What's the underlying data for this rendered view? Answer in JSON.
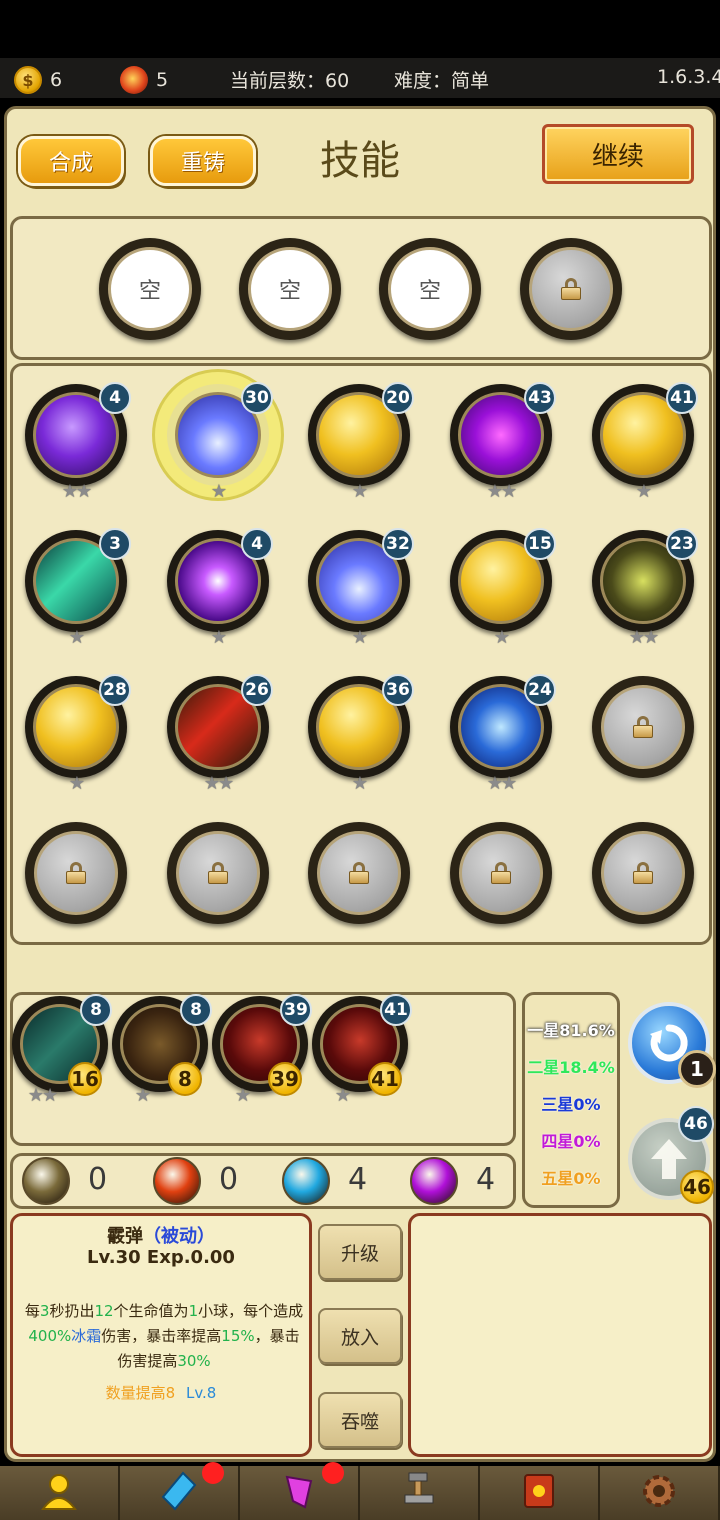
{
  "status_bar": {
    "coins": "6",
    "gems": "5",
    "floor": "当前层数：60",
    "difficulty": "难度：简单",
    "version": "1.6.3.4"
  },
  "header": {
    "merge_label": "合成",
    "recast_label": "重铸",
    "title": "技能",
    "continue_label": "继续"
  },
  "equip_slots": [
    {
      "label": "空"
    },
    {
      "label": "空"
    },
    {
      "label": "空"
    },
    {
      "label": "",
      "locked": true
    }
  ],
  "skills": [
    {
      "level": "4",
      "stars": 2,
      "icon": "purple-lightning-icon"
    },
    {
      "level": "30",
      "stars": 1,
      "icon": "ice-shard-icon",
      "selected": true
    },
    {
      "level": "20",
      "stars": 1,
      "icon": "gold-scroll-icon"
    },
    {
      "level": "43",
      "stars": 2,
      "icon": "purple-vortex-icon"
    },
    {
      "level": "41",
      "stars": 1,
      "icon": "gold-scroll-icon"
    },
    {
      "level": "3",
      "stars": 1,
      "icon": "green-wind-icon"
    },
    {
      "level": "4",
      "stars": 1,
      "icon": "purple-burst-icon"
    },
    {
      "level": "32",
      "stars": 1,
      "icon": "ice-shard-icon"
    },
    {
      "level": "15",
      "stars": 1,
      "icon": "gold-scroll-icon"
    },
    {
      "level": "23",
      "stars": 2,
      "icon": "dark-thunder-icon"
    },
    {
      "level": "28",
      "stars": 1,
      "icon": "gold-scroll-icon"
    },
    {
      "level": "26",
      "stars": 2,
      "icon": "red-shield-icon"
    },
    {
      "level": "36",
      "stars": 1,
      "icon": "gold-scroll-icon"
    },
    {
      "level": "24",
      "stars": 2,
      "icon": "blue-crystal-icon"
    },
    {
      "level": "",
      "locked": true
    },
    {
      "level": "",
      "locked": true
    },
    {
      "level": "",
      "locked": true
    },
    {
      "level": "",
      "locked": true
    },
    {
      "level": "",
      "locked": true
    },
    {
      "level": "",
      "locked": true
    }
  ],
  "inventory": [
    {
      "level": "8",
      "count": "16",
      "stars": 2,
      "icon": "teal-wind-icon"
    },
    {
      "level": "8",
      "count": "8",
      "stars": 1,
      "icon": "cross-icon"
    },
    {
      "level": "39",
      "count": "39",
      "stars": 1,
      "icon": "red-drop-icon"
    },
    {
      "level": "41",
      "count": "41",
      "stars": 1,
      "icon": "red-drop-icon"
    }
  ],
  "star_odds": [
    {
      "text": "一星81.6%",
      "color": "#ffffff"
    },
    {
      "text": "二星18.4%",
      "color": "#2ee85a"
    },
    {
      "text": "三星0%",
      "color": "#1a3ad8"
    },
    {
      "text": "四星0%",
      "color": "#c21ad8"
    },
    {
      "text": "五星0%",
      "color": "#f0a020"
    }
  ],
  "refresh": {
    "count": "1"
  },
  "upgrade": {
    "level": "46",
    "count": "46"
  },
  "orbs": [
    {
      "value": "0",
      "color": "#7a6a3a"
    },
    {
      "value": "0",
      "color": "#e04010"
    },
    {
      "value": "4",
      "color": "#20a8e0"
    },
    {
      "value": "4",
      "color": "#b010d8"
    }
  ],
  "detail": {
    "name": "霰弹",
    "tag": "（被动）",
    "level_exp": "Lv.30 Exp.0.00",
    "desc_parts": [
      {
        "t": "每",
        "c": ""
      },
      {
        "t": "3",
        "c": "#22b24c"
      },
      {
        "t": "秒扔出",
        "c": ""
      },
      {
        "t": "12",
        "c": "#22b24c"
      },
      {
        "t": "个生命值为",
        "c": ""
      },
      {
        "t": "1",
        "c": "#22b24c"
      },
      {
        "t": "小球，每个造成",
        "c": ""
      },
      {
        "t": "400%",
        "c": "#22b24c"
      },
      {
        "t": "冰霜",
        "c": "#2a6ad8"
      },
      {
        "t": "伤害，暴击率提高",
        "c": ""
      },
      {
        "t": "15%",
        "c": "#22b24c"
      },
      {
        "t": "，暴击伤害提高",
        "c": ""
      },
      {
        "t": "30%",
        "c": "#22b24c"
      }
    ],
    "bonus": "数量提高8",
    "bonus_level": "Lv.8"
  },
  "actions": {
    "upgrade": "升级",
    "put_in": "放入",
    "devour": "吞噬"
  },
  "nav": [
    {
      "icon": "hero-icon",
      "dot": false
    },
    {
      "icon": "crystal-icon",
      "dot": true
    },
    {
      "icon": "potion-icon",
      "dot": true
    },
    {
      "icon": "forge-icon",
      "dot": false
    },
    {
      "icon": "spellbook-icon",
      "dot": false
    },
    {
      "icon": "settings-gear-icon",
      "dot": false
    }
  ]
}
